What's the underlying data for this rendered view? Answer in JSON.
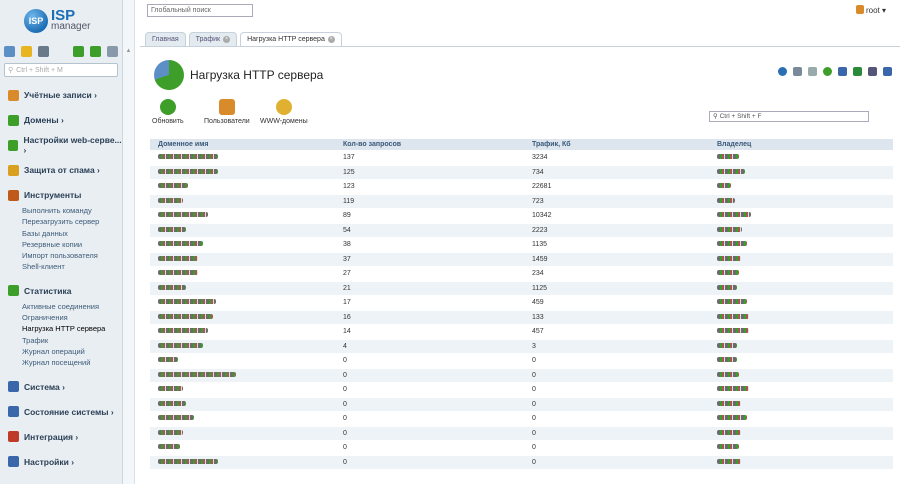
{
  "logo": {
    "badge": "ISP",
    "title": "ISP",
    "subtitle": "manager"
  },
  "sidebar": {
    "search_placeholder": "Ctrl + Shift + M",
    "sections": [
      {
        "label": "Учётные записи ›",
        "subitems": []
      },
      {
        "label": "Домены ›",
        "subitems": []
      },
      {
        "label": "Настройки web-серве... ›",
        "subitems": []
      },
      {
        "label": "Защита от спама ›",
        "subitems": []
      },
      {
        "label": "Инструменты",
        "subitems": [
          "Выполнить команду",
          "Перезагрузить сервер",
          "Базы данных",
          "Резервные копии",
          "Импорт пользователя",
          "Shell-клиент"
        ]
      },
      {
        "label": "Статистика",
        "subitems": [
          "Активные соединения",
          "Ограничения",
          "Нагрузка HTTP сервера",
          "Трафик",
          "Журнал операций",
          "Журнал посещений"
        ]
      },
      {
        "label": "Система ›",
        "subitems": []
      },
      {
        "label": "Состояние системы ›",
        "subitems": []
      },
      {
        "label": "Интеграция ›",
        "subitems": []
      },
      {
        "label": "Настройки ›",
        "subitems": []
      }
    ],
    "current_item": "Нагрузка HTTP сервера"
  },
  "header": {
    "search_placeholder": "Глобальный поиск",
    "user": "root"
  },
  "tabs": [
    {
      "label": "Главная"
    },
    {
      "label": "Трафик"
    },
    {
      "label": "Нагрузка HTTP сервера"
    }
  ],
  "page": {
    "title": "Нагрузка HTTP сервера",
    "filter_placeholder": "Ctrl + Shift + F"
  },
  "toolbar": [
    {
      "label": "Обновить"
    },
    {
      "label": "Пользователи"
    },
    {
      "label": "WWW-домены"
    }
  ],
  "table": {
    "columns": [
      "Доменное имя",
      "Кол-во запросов",
      "Трафик, Кб",
      "Владелец"
    ],
    "rows": [
      {
        "requests": "137",
        "traffic": "3234"
      },
      {
        "requests": "125",
        "traffic": "734"
      },
      {
        "requests": "123",
        "traffic": "22681"
      },
      {
        "requests": "119",
        "traffic": "723"
      },
      {
        "requests": "89",
        "traffic": "10342"
      },
      {
        "requests": "54",
        "traffic": "2223"
      },
      {
        "requests": "38",
        "traffic": "1135"
      },
      {
        "requests": "37",
        "traffic": "1459"
      },
      {
        "requests": "27",
        "traffic": "234"
      },
      {
        "requests": "21",
        "traffic": "1125"
      },
      {
        "requests": "17",
        "traffic": "459"
      },
      {
        "requests": "16",
        "traffic": "133"
      },
      {
        "requests": "14",
        "traffic": "457"
      },
      {
        "requests": "4",
        "traffic": "3"
      },
      {
        "requests": "0",
        "traffic": "0"
      },
      {
        "requests": "0",
        "traffic": "0"
      },
      {
        "requests": "0",
        "traffic": "0"
      },
      {
        "requests": "0",
        "traffic": "0"
      },
      {
        "requests": "0",
        "traffic": "0"
      },
      {
        "requests": "0",
        "traffic": "0"
      },
      {
        "requests": "0",
        "traffic": "0"
      },
      {
        "requests": "0",
        "traffic": "0"
      }
    ]
  }
}
